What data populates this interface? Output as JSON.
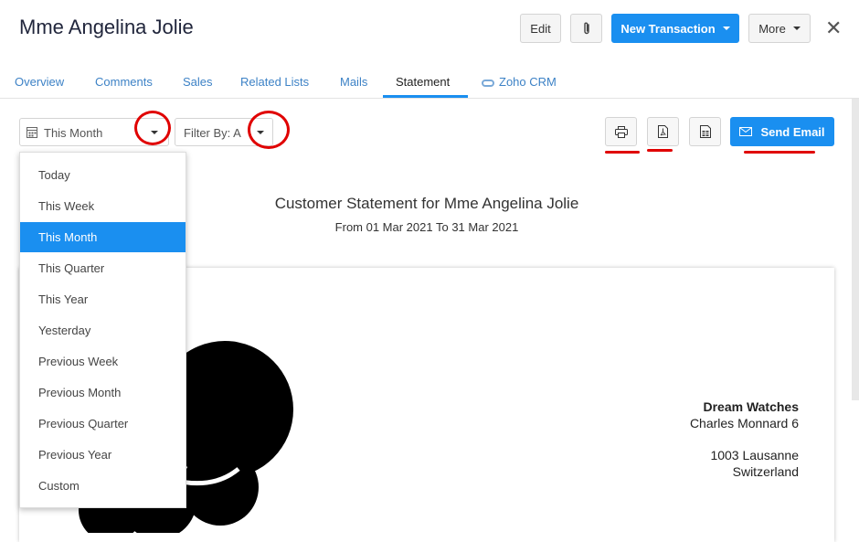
{
  "header": {
    "title": "Mme Angelina Jolie",
    "edit_label": "Edit",
    "attach_icon": "paperclip-icon",
    "new_transaction_label": "New Transaction",
    "more_label": "More",
    "close_symbol": "✕"
  },
  "tabs": [
    {
      "label": "Overview"
    },
    {
      "label": "Comments"
    },
    {
      "label": "Sales"
    },
    {
      "label": "Related Lists"
    },
    {
      "label": "Mails"
    },
    {
      "label": "Statement"
    },
    {
      "label": "Zoho CRM"
    }
  ],
  "active_tab": "Statement",
  "toolbar": {
    "period_value": "This Month",
    "filter_value": "Filter By: A",
    "send_email_label": "Send Email"
  },
  "period_menu": {
    "options": [
      "Today",
      "This Week",
      "This Month",
      "This Quarter",
      "This Year",
      "Yesterday",
      "Previous Week",
      "Previous Month",
      "Previous Quarter",
      "Previous Year",
      "Custom"
    ],
    "selected": "This Month"
  },
  "statement": {
    "title": "Customer Statement for Mme Angelina Jolie",
    "range": "From 01 Mar 2021 To 31 Mar 2021",
    "company_name": "Dream Watches",
    "address_line1": "Charles Monnard 6",
    "address_line2": "1003 Lausanne",
    "address_line3": "Switzerland"
  },
  "colors": {
    "accent": "#1a8ff0",
    "annotation_red": "#e00000",
    "link": "#3d82c6"
  }
}
